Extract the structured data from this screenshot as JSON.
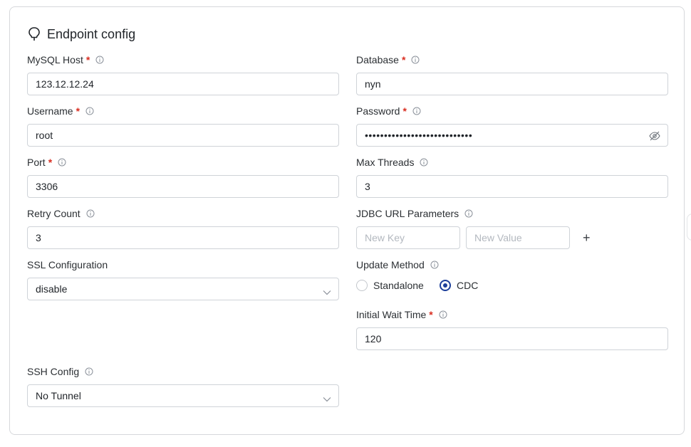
{
  "card": {
    "title": "Endpoint config",
    "title_icon": "lightbulb-icon"
  },
  "fields": {
    "mysql_host": {
      "label": "MySQL Host",
      "required": "*",
      "value": "123.12.12.24"
    },
    "database": {
      "label": "Database",
      "required": "*",
      "value": "nyn"
    },
    "username": {
      "label": "Username",
      "required": "*",
      "value": "root"
    },
    "password": {
      "label": "Password",
      "required": "*",
      "value": "••••••••••••••••••••••••••••"
    },
    "port": {
      "label": "Port",
      "required": "*",
      "value": "3306"
    },
    "max_threads": {
      "label": "Max Threads",
      "value": "3"
    },
    "retry_count": {
      "label": "Retry Count",
      "value": "3"
    },
    "jdbc_params": {
      "label": "JDBC URL Parameters",
      "key_placeholder": "New Key",
      "value_placeholder": "New Value",
      "add_symbol": "+"
    },
    "ssl_config": {
      "label": "SSL Configuration",
      "value": "disable"
    },
    "update_method": {
      "label": "Update Method",
      "options": [
        "Standalone",
        "CDC"
      ],
      "selected": "CDC"
    },
    "initial_wait": {
      "label": "Initial Wait Time",
      "required": "*",
      "value": "120"
    },
    "ssh_config": {
      "label": "SSH Config",
      "value": "No Tunnel"
    }
  },
  "colors": {
    "required": "#d92d20",
    "radio_accent": "#1d3f9a",
    "border": "#cfd3d8"
  }
}
